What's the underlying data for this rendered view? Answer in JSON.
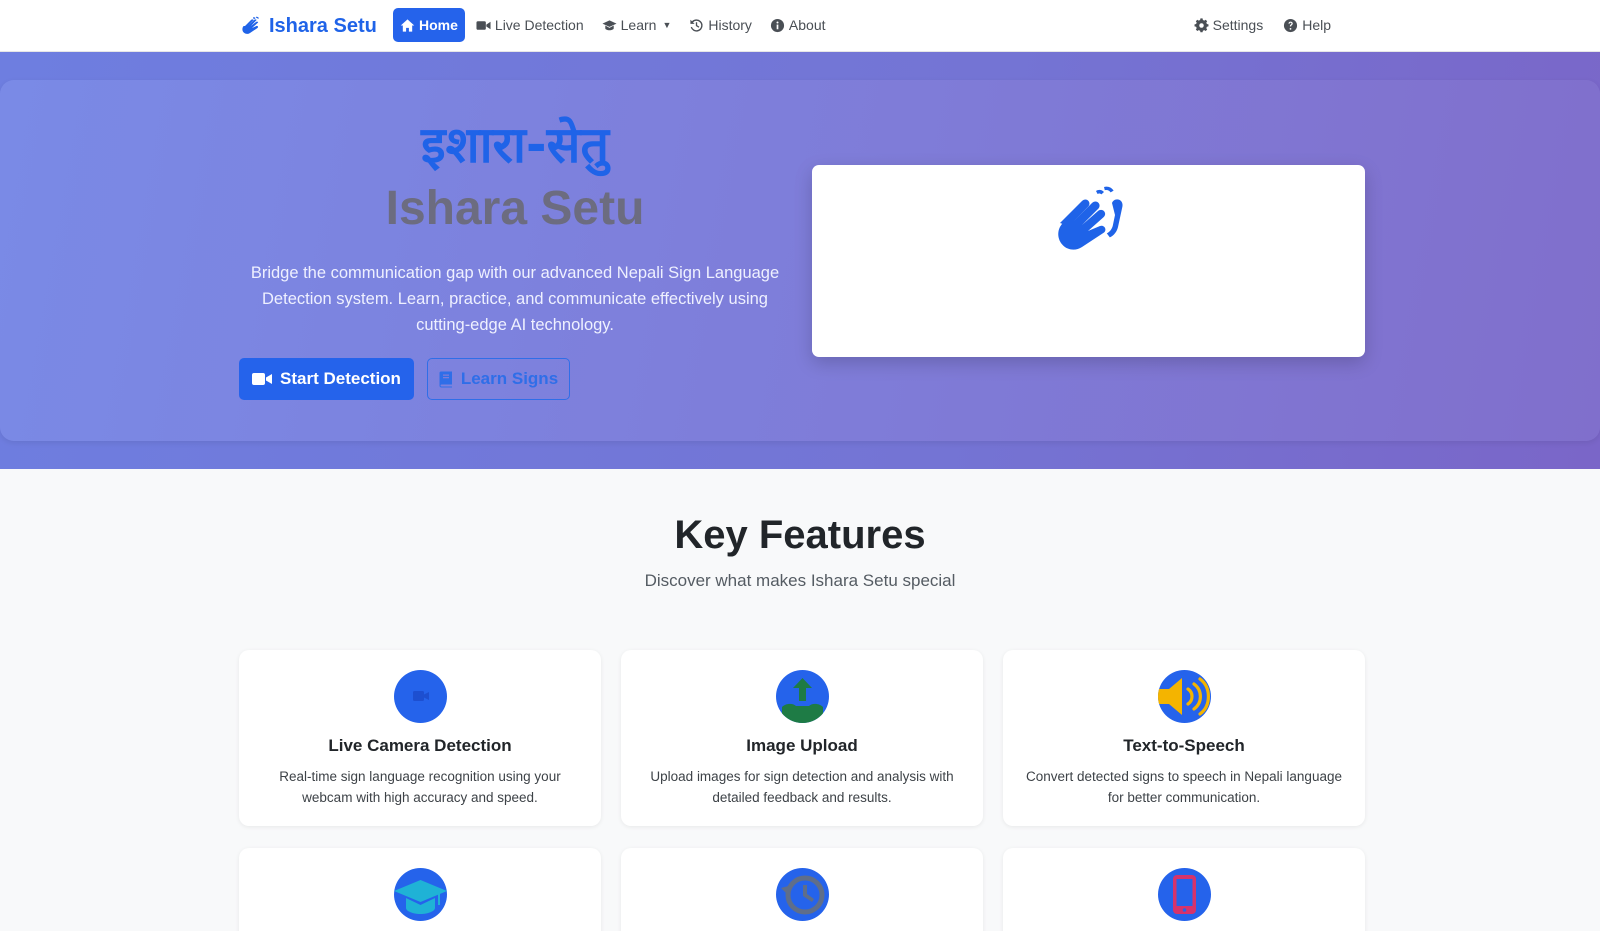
{
  "nav": {
    "brand": "Ishara Setu",
    "items": [
      {
        "label": "Home",
        "icon": "home-icon"
      },
      {
        "label": "Live Detection",
        "icon": "video-icon"
      },
      {
        "label": "Learn",
        "icon": "graduation-cap-icon"
      },
      {
        "label": "History",
        "icon": "history-icon"
      },
      {
        "label": "About",
        "icon": "info-circle-icon"
      }
    ],
    "right_items": [
      {
        "label": "Settings",
        "icon": "gear-icon"
      },
      {
        "label": "Help",
        "icon": "question-circle-icon"
      }
    ]
  },
  "hero": {
    "title_nepali": "इशारा-सेतु",
    "title_english": "Ishara Setu",
    "description": "Bridge the communication gap with our advanced Nepali Sign Language Detection system. Learn, practice, and communicate effectively using cutting-edge AI technology.",
    "primary_button": "Start Detection",
    "secondary_button": "Learn Signs",
    "card_icon": "sign-language-hands-icon"
  },
  "features": {
    "title": "Key Features",
    "subtitle": "Discover what makes Ishara Setu special",
    "cards": [
      {
        "title": "Live Camera Detection",
        "description": "Real-time sign language recognition using your webcam with high accuracy and speed.",
        "icon": "camera-icon"
      },
      {
        "title": "Image Upload",
        "description": "Upload images for sign detection and analysis with detailed feedback and results.",
        "icon": "upload-icon"
      },
      {
        "title": "Text-to-Speech",
        "description": "Convert detected signs to speech in Nepali language for better communication.",
        "icon": "volume-icon"
      },
      {
        "title": "",
        "description": "",
        "icon": "graduation-cap-icon"
      },
      {
        "title": "",
        "description": "",
        "icon": "history-icon"
      },
      {
        "title": "",
        "description": "",
        "icon": "mobile-icon"
      }
    ]
  },
  "colors": {
    "primary": "#2563eb",
    "hero_gradient_start": "#7a8ae6",
    "hero_gradient_end": "#806fcc",
    "muted_title": "#6c6c80"
  }
}
